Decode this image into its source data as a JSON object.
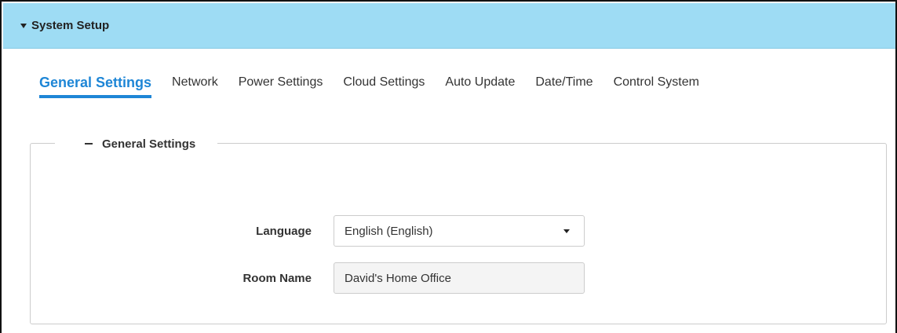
{
  "panel": {
    "title": "System Setup",
    "header_color": "#9edcf4"
  },
  "tabs": [
    {
      "label": "General Settings",
      "active": true
    },
    {
      "label": "Network",
      "active": false
    },
    {
      "label": "Power Settings",
      "active": false
    },
    {
      "label": "Cloud Settings",
      "active": false
    },
    {
      "label": "Auto Update",
      "active": false
    },
    {
      "label": "Date/Time",
      "active": false
    },
    {
      "label": "Control System",
      "active": false
    }
  ],
  "accent_color": "#1e86d6",
  "section": {
    "title": "General Settings",
    "collapse_icon": "minus-icon"
  },
  "form": {
    "language": {
      "label": "Language",
      "value": "English (English)"
    },
    "room_name": {
      "label": "Room Name",
      "value": "David's Home Office"
    }
  }
}
